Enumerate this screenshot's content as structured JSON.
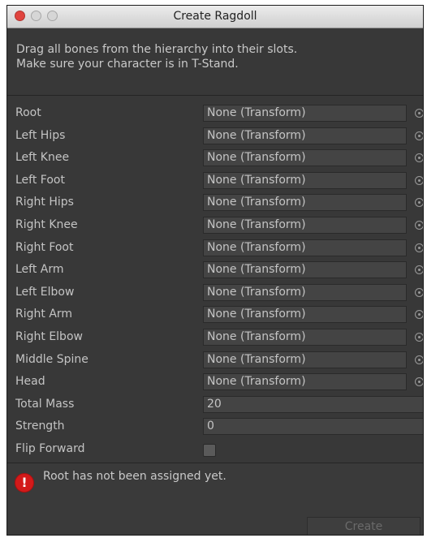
{
  "window": {
    "title": "Create Ragdoll"
  },
  "help": {
    "line1": "Drag all bones from the hierarchy into their slots.",
    "line2": "Make sure your character is in T-Stand."
  },
  "bones": [
    {
      "label": "Root",
      "value": "None (Transform)"
    },
    {
      "label": "Left Hips",
      "value": "None (Transform)"
    },
    {
      "label": "Left Knee",
      "value": "None (Transform)"
    },
    {
      "label": "Left Foot",
      "value": "None (Transform)"
    },
    {
      "label": "Right Hips",
      "value": "None (Transform)"
    },
    {
      "label": "Right Knee",
      "value": "None (Transform)"
    },
    {
      "label": "Right Foot",
      "value": "None (Transform)"
    },
    {
      "label": "Left Arm",
      "value": "None (Transform)"
    },
    {
      "label": "Left Elbow",
      "value": "None (Transform)"
    },
    {
      "label": "Right Arm",
      "value": "None (Transform)"
    },
    {
      "label": "Right Elbow",
      "value": "None (Transform)"
    },
    {
      "label": "Middle Spine",
      "value": "None (Transform)"
    },
    {
      "label": "Head",
      "value": "None (Transform)"
    }
  ],
  "total_mass": {
    "label": "Total Mass",
    "value": "20"
  },
  "strength": {
    "label": "Strength",
    "value": "0"
  },
  "flip_forward": {
    "label": "Flip Forward",
    "checked": false
  },
  "warning": {
    "text": "Root has not been assigned yet.",
    "icon": "error-icon"
  },
  "create_button": {
    "label": "Create",
    "enabled": false
  },
  "colors": {
    "panel_bg": "#383838",
    "error_red": "#d31a1a"
  }
}
